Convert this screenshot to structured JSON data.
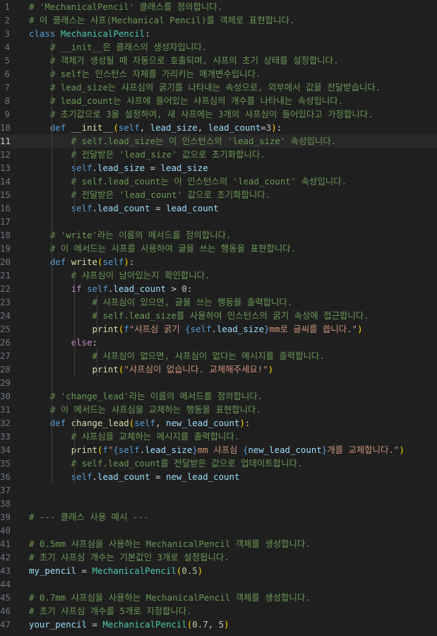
{
  "editor": {
    "current_line": 11,
    "lines": [
      [
        [
          "c",
          "# 'MechanicalPencil' 클래스를 정의합니다."
        ]
      ],
      [
        [
          "c",
          "# 이 클래스는 샤프(Mechanical Pencil)를 객체로 표현합니다."
        ]
      ],
      [
        [
          "k",
          "class"
        ],
        [
          "p",
          " "
        ],
        [
          "cl",
          "MechanicalPencil"
        ],
        [
          "p",
          ":"
        ]
      ],
      [
        [
          "p",
          "    "
        ],
        [
          "c",
          "# __init__은 클래스의 생성자입니다."
        ]
      ],
      [
        [
          "p",
          "    "
        ],
        [
          "c",
          "# 객체가 생성될 때 자동으로 호출되며, 샤프의 초기 상태를 설정합니다."
        ]
      ],
      [
        [
          "p",
          "    "
        ],
        [
          "c",
          "# self는 인스턴스 자체를 가리키는 매개변수입니다."
        ]
      ],
      [
        [
          "p",
          "    "
        ],
        [
          "c",
          "# lead_size는 샤프심의 굵기를 나타내는 속성으로, 외부에서 값을 전달받습니다."
        ]
      ],
      [
        [
          "p",
          "    "
        ],
        [
          "c",
          "# lead_count는 샤프에 들어있는 샤프심의 개수를 나타내는 속성입니다."
        ]
      ],
      [
        [
          "p",
          "    "
        ],
        [
          "c",
          "# 초기값으로 3을 설정하여, 새 샤프에는 3개의 샤프심이 들어있다고 가정합니다."
        ]
      ],
      [
        [
          "p",
          "    "
        ],
        [
          "k",
          "def"
        ],
        [
          "p",
          " "
        ],
        [
          "fn",
          "__init__"
        ],
        [
          "b1",
          "("
        ],
        [
          "k",
          "self"
        ],
        [
          "p",
          ", "
        ],
        [
          "v",
          "lead_size"
        ],
        [
          "p",
          ", "
        ],
        [
          "v",
          "lead_count"
        ],
        [
          "p",
          "="
        ],
        [
          "n",
          "3"
        ],
        [
          "b1",
          ")"
        ],
        [
          "p",
          ":"
        ]
      ],
      [
        [
          "p",
          "        "
        ],
        [
          "c",
          "# self.lead_size는 이 인스턴스의 'lead_size' 속성입니다."
        ]
      ],
      [
        [
          "p",
          "        "
        ],
        [
          "c",
          "# 전달받은 'lead_size' 값으로 초기화합니다."
        ]
      ],
      [
        [
          "p",
          "        "
        ],
        [
          "k",
          "self"
        ],
        [
          "p",
          "."
        ],
        [
          "v",
          "lead_size"
        ],
        [
          "p",
          " = "
        ],
        [
          "v",
          "lead_size"
        ]
      ],
      [
        [
          "p",
          "        "
        ],
        [
          "c",
          "# self.lead_count는 이 인스턴스의 'lead_count' 속성입니다."
        ]
      ],
      [
        [
          "p",
          "        "
        ],
        [
          "c",
          "# 전달받은 'lead_count' 값으로 초기화합니다."
        ]
      ],
      [
        [
          "p",
          "        "
        ],
        [
          "k",
          "self"
        ],
        [
          "p",
          "."
        ],
        [
          "v",
          "lead_count"
        ],
        [
          "p",
          " = "
        ],
        [
          "v",
          "lead_count"
        ]
      ],
      [],
      [
        [
          "p",
          "    "
        ],
        [
          "c",
          "# 'write'라는 이름의 메서드를 정의합니다."
        ]
      ],
      [
        [
          "p",
          "    "
        ],
        [
          "c",
          "# 이 메서드는 샤프를 사용하여 글을 쓰는 행동을 표현합니다."
        ]
      ],
      [
        [
          "p",
          "    "
        ],
        [
          "k",
          "def"
        ],
        [
          "p",
          " "
        ],
        [
          "fn",
          "write"
        ],
        [
          "b1",
          "("
        ],
        [
          "k",
          "self"
        ],
        [
          "b1",
          ")"
        ],
        [
          "p",
          ":"
        ]
      ],
      [
        [
          "p",
          "        "
        ],
        [
          "c",
          "# 샤프심이 남아있는지 확인합니다."
        ]
      ],
      [
        [
          "p",
          "        "
        ],
        [
          "kc",
          "if"
        ],
        [
          "p",
          " "
        ],
        [
          "k",
          "self"
        ],
        [
          "p",
          "."
        ],
        [
          "v",
          "lead_count"
        ],
        [
          "p",
          " > "
        ],
        [
          "n",
          "0"
        ],
        [
          "p",
          ":"
        ]
      ],
      [
        [
          "p",
          "            "
        ],
        [
          "c",
          "# 샤프심이 있으면, 글을 쓰는 행동을 출력합니다."
        ]
      ],
      [
        [
          "p",
          "            "
        ],
        [
          "c",
          "# self.lead_size를 사용하여 인스턴스의 굵기 속성에 접근합니다."
        ]
      ],
      [
        [
          "p",
          "            "
        ],
        [
          "fn",
          "print"
        ],
        [
          "b1",
          "("
        ],
        [
          "k",
          "f"
        ],
        [
          "s",
          "\"샤프심 굵기 "
        ],
        [
          "k",
          "{"
        ],
        [
          "k",
          "self"
        ],
        [
          "p",
          "."
        ],
        [
          "v",
          "lead_size"
        ],
        [
          "k",
          "}"
        ],
        [
          "s",
          "mm로 글씨를 씁니다.\""
        ],
        [
          "b1",
          ")"
        ]
      ],
      [
        [
          "p",
          "        "
        ],
        [
          "kc",
          "else"
        ],
        [
          "p",
          ":"
        ]
      ],
      [
        [
          "p",
          "            "
        ],
        [
          "c",
          "# 샤프심이 없으면, 샤프심이 없다는 메시지를 출력합니다."
        ]
      ],
      [
        [
          "p",
          "            "
        ],
        [
          "fn",
          "print"
        ],
        [
          "b1",
          "("
        ],
        [
          "s",
          "\"샤프심이 없습니다. 교체해주세요!\""
        ],
        [
          "b1",
          ")"
        ]
      ],
      [],
      [
        [
          "p",
          "    "
        ],
        [
          "c",
          "# 'change_lead'라는 이름의 메서드를 정의합니다."
        ]
      ],
      [
        [
          "p",
          "    "
        ],
        [
          "c",
          "# 이 메서드는 샤프심을 교체하는 행동을 표현합니다."
        ]
      ],
      [
        [
          "p",
          "    "
        ],
        [
          "k",
          "def"
        ],
        [
          "p",
          " "
        ],
        [
          "fn",
          "change_lead"
        ],
        [
          "b1",
          "("
        ],
        [
          "k",
          "self"
        ],
        [
          "p",
          ", "
        ],
        [
          "v",
          "new_lead_count"
        ],
        [
          "b1",
          ")"
        ],
        [
          "p",
          ":"
        ]
      ],
      [
        [
          "p",
          "        "
        ],
        [
          "c",
          "# 샤프심을 교체하는 메시지를 출력합니다."
        ]
      ],
      [
        [
          "p",
          "        "
        ],
        [
          "fn",
          "print"
        ],
        [
          "b1",
          "("
        ],
        [
          "k",
          "f"
        ],
        [
          "s",
          "\""
        ],
        [
          "k",
          "{"
        ],
        [
          "k",
          "self"
        ],
        [
          "p",
          "."
        ],
        [
          "v",
          "lead_size"
        ],
        [
          "k",
          "}"
        ],
        [
          "s",
          "mm 샤프심 "
        ],
        [
          "k",
          "{"
        ],
        [
          "v",
          "new_lead_count"
        ],
        [
          "k",
          "}"
        ],
        [
          "s",
          "개를 교체합니다.\""
        ],
        [
          "b1",
          ")"
        ]
      ],
      [
        [
          "p",
          "        "
        ],
        [
          "c",
          "# self.lead_count를 전달받은 값으로 업데이트합니다."
        ]
      ],
      [
        [
          "p",
          "        "
        ],
        [
          "k",
          "self"
        ],
        [
          "p",
          "."
        ],
        [
          "v",
          "lead_count"
        ],
        [
          "p",
          " = "
        ],
        [
          "v",
          "new_lead_count"
        ]
      ],
      [],
      [],
      [
        [
          "c",
          "# --- 클래스 사용 예시 ---"
        ]
      ],
      [],
      [
        [
          "c",
          "# 0.5mm 샤프심을 사용하는 MechanicalPencil 객체를 생성합니다."
        ]
      ],
      [
        [
          "c",
          "# 초기 샤프심 개수는 기본값인 3개로 설정됩니다."
        ]
      ],
      [
        [
          "v",
          "my_pencil"
        ],
        [
          "p",
          " = "
        ],
        [
          "cl",
          "MechanicalPencil"
        ],
        [
          "b1",
          "("
        ],
        [
          "n",
          "0.5"
        ],
        [
          "b1",
          ")"
        ]
      ],
      [],
      [
        [
          "c",
          "# 0.7mm 샤프심을 사용하는 MechanicalPencil 객체를 생성합니다."
        ]
      ],
      [
        [
          "c",
          "# 초기 샤프심 개수를 5개로 지정합니다."
        ]
      ],
      [
        [
          "v",
          "your_pencil"
        ],
        [
          "p",
          " = "
        ],
        [
          "cl",
          "MechanicalPencil"
        ],
        [
          "b1",
          "("
        ],
        [
          "n",
          "0.7"
        ],
        [
          "p",
          ", "
        ],
        [
          "n",
          "5"
        ],
        [
          "b1",
          ")"
        ]
      ]
    ]
  }
}
